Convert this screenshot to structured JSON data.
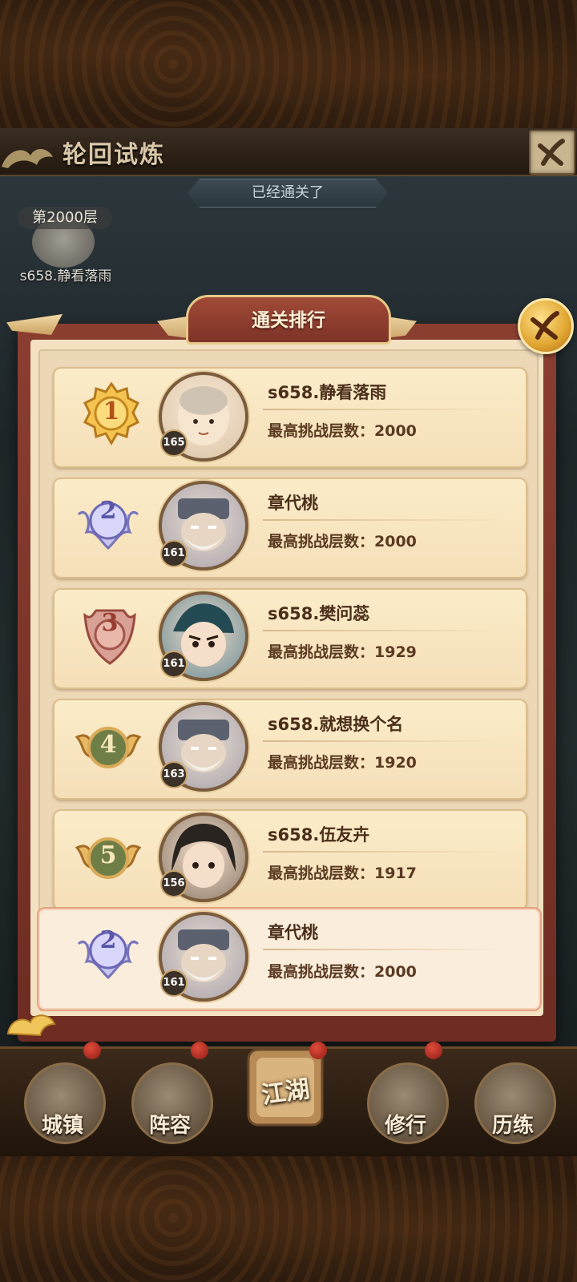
{
  "window": {
    "title": "轮回试炼",
    "cleared_text": "已经通关了"
  },
  "floor_badge": {
    "floor_label": "第2000层",
    "player_name": "s658.静看落雨"
  },
  "ranking_panel": {
    "title": "通关排行",
    "entries": [
      {
        "rank": "1",
        "name": "s658.静看落雨",
        "level": "165",
        "score_label": "最高挑战层数：2000",
        "medal": "gold"
      },
      {
        "rank": "2",
        "name": "章代桃",
        "level": "161",
        "score_label": "最高挑战层数：2000",
        "medal": "silver"
      },
      {
        "rank": "3",
        "name": "s658.樊问蕊",
        "level": "161",
        "score_label": "最高挑战层数：1929",
        "medal": "bronze"
      },
      {
        "rank": "4",
        "name": "s658.就想换个名",
        "level": "163",
        "score_label": "最高挑战层数：1920",
        "medal": "green"
      },
      {
        "rank": "5",
        "name": "s658.伍友卉",
        "level": "156",
        "score_label": "最高挑战层数：1917",
        "medal": "green"
      }
    ],
    "my_entry": {
      "rank": "2",
      "name": "章代桃",
      "level": "161",
      "score_label": "最高挑战层数：2000",
      "medal": "silver"
    }
  },
  "nav": {
    "items": [
      {
        "label": "城镇"
      },
      {
        "label": "阵容"
      },
      {
        "label": "江湖"
      },
      {
        "label": "修行"
      },
      {
        "label": "历练"
      }
    ]
  },
  "colors": {
    "panel_red": "#7d3327",
    "card_bg": "#f5dfb8",
    "text_brown": "#4a2e1a",
    "gold": "#e0a530"
  }
}
